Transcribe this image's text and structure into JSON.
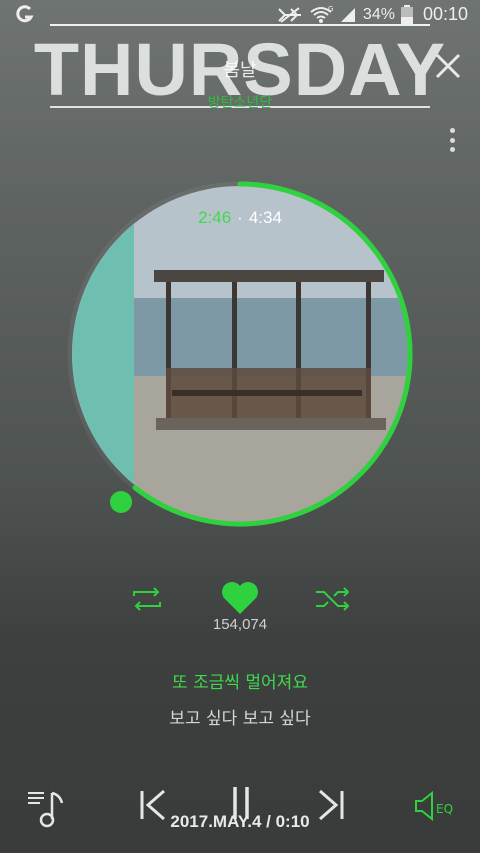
{
  "status_bar": {
    "battery": "34%",
    "time": "00:10",
    "signal_label": "G"
  },
  "header": {
    "overlay_title": "THURSDAY",
    "song_title": "봄날",
    "artist": "방탄소년단"
  },
  "player": {
    "current_time": "2:46",
    "separator": "·",
    "total_time": "4:34",
    "progress_fraction": 0.606,
    "like_count": "154,074"
  },
  "lyrics": {
    "current": "또 조금씩 멀어져요",
    "next": "보고 싶다 보고 싶다"
  },
  "bottom": {
    "date_time_stamp": "2017.MAY.4 / 0:10",
    "eq_label": "EQ"
  },
  "colors": {
    "accent": "#2fd13e",
    "teal_panel": "#6fbfb0"
  },
  "icons": [
    "app-logo-icon",
    "mute-icon",
    "wifi-icon",
    "signal-icon",
    "battery-icon",
    "close-icon",
    "more-vert-icon",
    "repeat-icon",
    "heart-icon",
    "shuffle-icon",
    "playlist-icon",
    "skip-previous-icon",
    "pause-icon",
    "skip-next-icon",
    "equalizer-icon"
  ]
}
